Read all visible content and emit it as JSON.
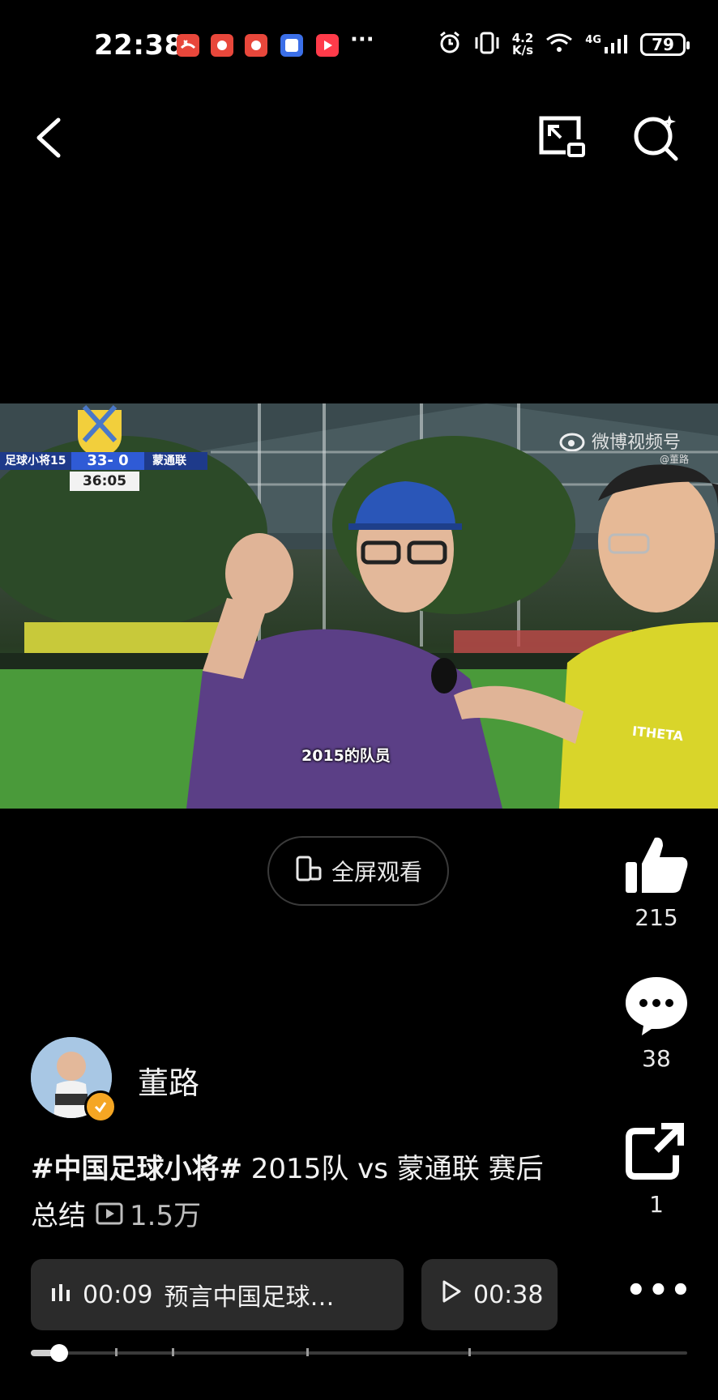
{
  "status_bar": {
    "time": "22:38",
    "net_speed_value": "4.2",
    "net_speed_unit": "K/s",
    "network": "4G",
    "battery": "79",
    "notification_icons": [
      "missed-call-icon",
      "huawei-app-icon",
      "huawei-app-icon",
      "tieba-icon",
      "video-app-icon"
    ]
  },
  "top_bar": {
    "icons": [
      "back-icon",
      "picture-in-picture-icon",
      "search-icon"
    ]
  },
  "video": {
    "scoreboard": {
      "team_left": "足球小将15",
      "score": "33- 0",
      "team_right": "蒙通联",
      "clock": "36:05"
    },
    "watermark": "微博视频号",
    "watermark_sub": "@董路",
    "subtitle": "2015的队员",
    "shirt_text": "ITHETA"
  },
  "fullscreen_label": "全屏观看",
  "actions": {
    "like_count": "215",
    "comment_count": "38",
    "share_count": "1"
  },
  "author": {
    "name": "董路"
  },
  "caption": {
    "hashtag": "#中国足球小将#",
    "text": " 2015队 vs 蒙通联 赛后总结",
    "views": "1.5万"
  },
  "chapters": [
    {
      "time": "00:09",
      "title": "预言中国足球…"
    },
    {
      "time": "00:38",
      "title": ""
    }
  ],
  "progress": 0.03,
  "colors": {
    "background": "#000000",
    "chip": "#2b2b2b",
    "verified": "#f5a623",
    "kit_yellow": "#d9d52a",
    "shirt_purple": "#5b3f86"
  }
}
